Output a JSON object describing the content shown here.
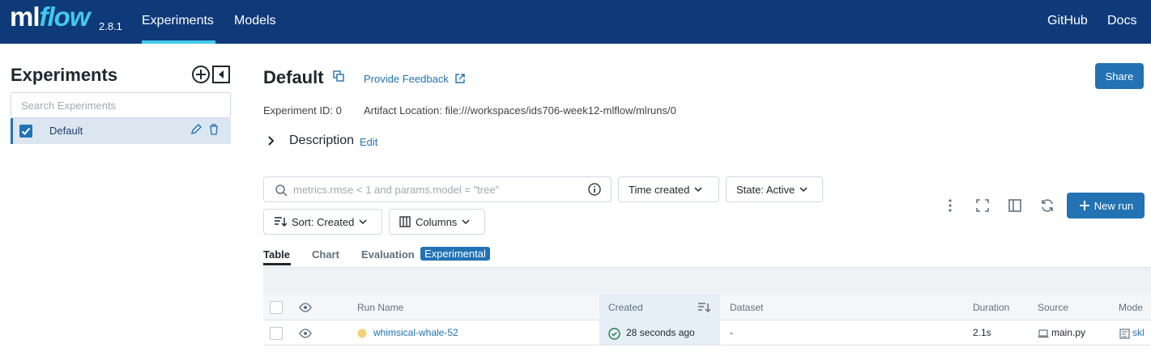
{
  "header": {
    "logo_ml": "ml",
    "logo_flow": "flow",
    "version": "2.8.1",
    "nav": [
      "Experiments",
      "Models"
    ],
    "right_links": [
      "GitHub",
      "Docs"
    ],
    "brand_color": "#0e3a7a",
    "accent_color": "#43c9ed"
  },
  "sidebar": {
    "title": "Experiments",
    "search_placeholder": "Search Experiments",
    "experiments": [
      {
        "name": "Default",
        "checked": true
      }
    ]
  },
  "main": {
    "title": "Default",
    "feedback_label": "Provide Feedback",
    "share_label": "Share",
    "experiment_id": "Experiment ID: 0",
    "artifact_location": "Artifact Location: file:///workspaces/ids706-week12-mlflow/mlruns/0",
    "description_label": "Description",
    "edit_label": "Edit",
    "filter_placeholder": "metrics.rmse < 1 and params.model = \"tree\"",
    "time_created_label": "Time created",
    "state_label": "State: Active",
    "sort_label": "Sort: Created",
    "columns_label": "Columns",
    "new_run_label": "New run",
    "tabs": [
      "Table",
      "Chart",
      "Evaluation"
    ],
    "experimental_badge": "Experimental"
  },
  "table": {
    "headers": {
      "run_name": "Run Name",
      "created": "Created",
      "dataset": "Dataset",
      "duration": "Duration",
      "source": "Source",
      "models": "Mode"
    },
    "rows": [
      {
        "run_name": "whimsical-whale-52",
        "created": "28 seconds ago",
        "dataset": "-",
        "duration": "2.1s",
        "source": "main.py",
        "model": "skl"
      }
    ]
  }
}
